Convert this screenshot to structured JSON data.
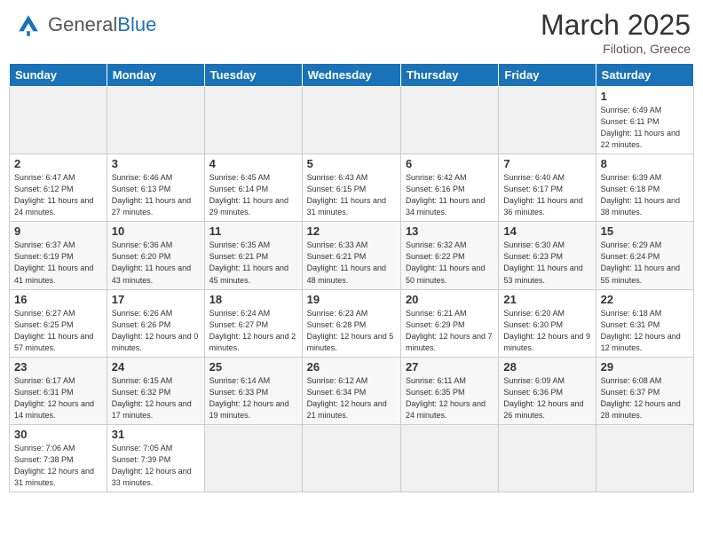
{
  "header": {
    "logo_general": "General",
    "logo_blue": "Blue",
    "month": "March 2025",
    "location": "Filotion, Greece"
  },
  "days_of_week": [
    "Sunday",
    "Monday",
    "Tuesday",
    "Wednesday",
    "Thursday",
    "Friday",
    "Saturday"
  ],
  "weeks": [
    {
      "alt": false,
      "days": [
        {
          "num": "",
          "info": ""
        },
        {
          "num": "",
          "info": ""
        },
        {
          "num": "",
          "info": ""
        },
        {
          "num": "",
          "info": ""
        },
        {
          "num": "",
          "info": ""
        },
        {
          "num": "",
          "info": ""
        },
        {
          "num": "1",
          "info": "Sunrise: 6:49 AM\nSunset: 6:11 PM\nDaylight: 11 hours\nand 22 minutes."
        }
      ]
    },
    {
      "alt": false,
      "days": [
        {
          "num": "2",
          "info": "Sunrise: 6:47 AM\nSunset: 6:12 PM\nDaylight: 11 hours\nand 24 minutes."
        },
        {
          "num": "3",
          "info": "Sunrise: 6:46 AM\nSunset: 6:13 PM\nDaylight: 11 hours\nand 27 minutes."
        },
        {
          "num": "4",
          "info": "Sunrise: 6:45 AM\nSunset: 6:14 PM\nDaylight: 11 hours\nand 29 minutes."
        },
        {
          "num": "5",
          "info": "Sunrise: 6:43 AM\nSunset: 6:15 PM\nDaylight: 11 hours\nand 31 minutes."
        },
        {
          "num": "6",
          "info": "Sunrise: 6:42 AM\nSunset: 6:16 PM\nDaylight: 11 hours\nand 34 minutes."
        },
        {
          "num": "7",
          "info": "Sunrise: 6:40 AM\nSunset: 6:17 PM\nDaylight: 11 hours\nand 36 minutes."
        },
        {
          "num": "8",
          "info": "Sunrise: 6:39 AM\nSunset: 6:18 PM\nDaylight: 11 hours\nand 38 minutes."
        }
      ]
    },
    {
      "alt": true,
      "days": [
        {
          "num": "9",
          "info": "Sunrise: 6:37 AM\nSunset: 6:19 PM\nDaylight: 11 hours\nand 41 minutes."
        },
        {
          "num": "10",
          "info": "Sunrise: 6:36 AM\nSunset: 6:20 PM\nDaylight: 11 hours\nand 43 minutes."
        },
        {
          "num": "11",
          "info": "Sunrise: 6:35 AM\nSunset: 6:21 PM\nDaylight: 11 hours\nand 45 minutes."
        },
        {
          "num": "12",
          "info": "Sunrise: 6:33 AM\nSunset: 6:21 PM\nDaylight: 11 hours\nand 48 minutes."
        },
        {
          "num": "13",
          "info": "Sunrise: 6:32 AM\nSunset: 6:22 PM\nDaylight: 11 hours\nand 50 minutes."
        },
        {
          "num": "14",
          "info": "Sunrise: 6:30 AM\nSunset: 6:23 PM\nDaylight: 11 hours\nand 53 minutes."
        },
        {
          "num": "15",
          "info": "Sunrise: 6:29 AM\nSunset: 6:24 PM\nDaylight: 11 hours\nand 55 minutes."
        }
      ]
    },
    {
      "alt": false,
      "days": [
        {
          "num": "16",
          "info": "Sunrise: 6:27 AM\nSunset: 6:25 PM\nDaylight: 11 hours\nand 57 minutes."
        },
        {
          "num": "17",
          "info": "Sunrise: 6:26 AM\nSunset: 6:26 PM\nDaylight: 12 hours\nand 0 minutes."
        },
        {
          "num": "18",
          "info": "Sunrise: 6:24 AM\nSunset: 6:27 PM\nDaylight: 12 hours\nand 2 minutes."
        },
        {
          "num": "19",
          "info": "Sunrise: 6:23 AM\nSunset: 6:28 PM\nDaylight: 12 hours\nand 5 minutes."
        },
        {
          "num": "20",
          "info": "Sunrise: 6:21 AM\nSunset: 6:29 PM\nDaylight: 12 hours\nand 7 minutes."
        },
        {
          "num": "21",
          "info": "Sunrise: 6:20 AM\nSunset: 6:30 PM\nDaylight: 12 hours\nand 9 minutes."
        },
        {
          "num": "22",
          "info": "Sunrise: 6:18 AM\nSunset: 6:31 PM\nDaylight: 12 hours\nand 12 minutes."
        }
      ]
    },
    {
      "alt": true,
      "days": [
        {
          "num": "23",
          "info": "Sunrise: 6:17 AM\nSunset: 6:31 PM\nDaylight: 12 hours\nand 14 minutes."
        },
        {
          "num": "24",
          "info": "Sunrise: 6:15 AM\nSunset: 6:32 PM\nDaylight: 12 hours\nand 17 minutes."
        },
        {
          "num": "25",
          "info": "Sunrise: 6:14 AM\nSunset: 6:33 PM\nDaylight: 12 hours\nand 19 minutes."
        },
        {
          "num": "26",
          "info": "Sunrise: 6:12 AM\nSunset: 6:34 PM\nDaylight: 12 hours\nand 21 minutes."
        },
        {
          "num": "27",
          "info": "Sunrise: 6:11 AM\nSunset: 6:35 PM\nDaylight: 12 hours\nand 24 minutes."
        },
        {
          "num": "28",
          "info": "Sunrise: 6:09 AM\nSunset: 6:36 PM\nDaylight: 12 hours\nand 26 minutes."
        },
        {
          "num": "29",
          "info": "Sunrise: 6:08 AM\nSunset: 6:37 PM\nDaylight: 12 hours\nand 28 minutes."
        }
      ]
    },
    {
      "alt": false,
      "days": [
        {
          "num": "30",
          "info": "Sunrise: 7:06 AM\nSunset: 7:38 PM\nDaylight: 12 hours\nand 31 minutes."
        },
        {
          "num": "31",
          "info": "Sunrise: 7:05 AM\nSunset: 7:39 PM\nDaylight: 12 hours\nand 33 minutes."
        },
        {
          "num": "",
          "info": ""
        },
        {
          "num": "",
          "info": ""
        },
        {
          "num": "",
          "info": ""
        },
        {
          "num": "",
          "info": ""
        },
        {
          "num": "",
          "info": ""
        }
      ]
    }
  ]
}
